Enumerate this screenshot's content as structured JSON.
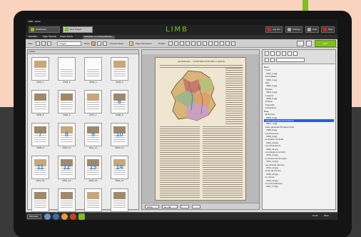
{
  "window": {
    "title": "LIMB - Admin"
  },
  "appbar": {
    "dashboard_label": "Dashboard",
    "new_project_label": "New Project",
    "logo": "LIMB",
    "log_out": "Log Out",
    "settings": "Settings",
    "help": "Help",
    "stop": "Stop"
  },
  "tabs": [
    "Workflow",
    "Page Spreads",
    "Project Name",
    "Workflow: Le France Illustrée..."
  ],
  "toolbar": {
    "view_label": "View",
    "images_dropdown": "Images",
    "show_label": "Show",
    "preview_label": "Preview Mode",
    "page_permission": "Page Permission",
    "toolbar_label": "Toolbar",
    "next_label": "Next"
  },
  "left_panel": {
    "header": "Folder"
  },
  "thumbnails": [
    {
      "label": "0001_1",
      "num": ""
    },
    {
      "label": "0002_2",
      "num": ""
    },
    {
      "label": "0003_3",
      "num": ""
    },
    {
      "label": "0004_4",
      "num": ""
    },
    {
      "label": "0005_5",
      "num": ""
    },
    {
      "label": "0006_6",
      "num": ""
    },
    {
      "label": "0007_7",
      "num": ""
    },
    {
      "label": "0008_8",
      "num": "6"
    },
    {
      "label": "0009_9",
      "num": "7"
    },
    {
      "label": "0010_10",
      "num": "8"
    },
    {
      "label": "0011_11",
      "num": "9"
    },
    {
      "label": "0012_12",
      "num": "10"
    },
    {
      "label": "0013_13",
      "num": "11"
    },
    {
      "label": "0014_14",
      "num": "12"
    },
    {
      "label": "0015_15",
      "num": "13"
    },
    {
      "label": "0016_16",
      "num": "14"
    },
    {
      "label": "0017_17",
      "num": ""
    },
    {
      "label": "0018_18",
      "num": ""
    },
    {
      "label": "0019_19",
      "num": ""
    },
    {
      "label": "0020_20",
      "num": ""
    }
  ],
  "center": {
    "page_title": "LE FRANCE — CONSTRUCTION DE LA GAULE",
    "zoom_label": "100%",
    "page_count": "12 / 48"
  },
  "tree": [
    "Book",
    "  Cover",
    "    0001_1.jpg",
    "  Front Matter",
    "    0002_2.jpg",
    "  Title",
    "    0003_3.jpg",
    "  Preface",
    "    0004_4.jpg",
    "  Contents",
    "    0005_5.jpg",
    "  Preface",
    "  Copyright",
    "  Introduction",
    "Body",
    "  All France",
    "    0006_6.jpg",
    "  Cartes générales de la France",
    "    0007_7.jpg",
    "  Carte générale Physique Nord",
    "    0008_8.jpg",
    "  Les Provinces",
    "    0009_9.jpg",
    "  La France Centrale",
    "    0010_10.jpg",
    "  Les Provinces II",
    "    0011_11.jpg",
    "  Les Regions du Nord",
    "    0012_12.jpg",
    "  La France Nord-Ouest",
    "    0013_13.jpg",
    "  Les Grands Fleuves",
    "    0014_14.jpg",
    "  La Ile-de-France",
    "    0015_15.jpg",
    "  Le Centre",
    "    0016_16.jpg",
    "  La Loire Inférieure",
    "    0017_17.jpg"
  ],
  "tree_selected_index": 17,
  "taskbar": {
    "start_label": "Windows",
    "time": "12:41",
    "date": "2012"
  },
  "colors": {
    "accent_green": "#7fbf1f",
    "selection_blue": "#2b5fcf",
    "stop_red": "#d42020"
  }
}
